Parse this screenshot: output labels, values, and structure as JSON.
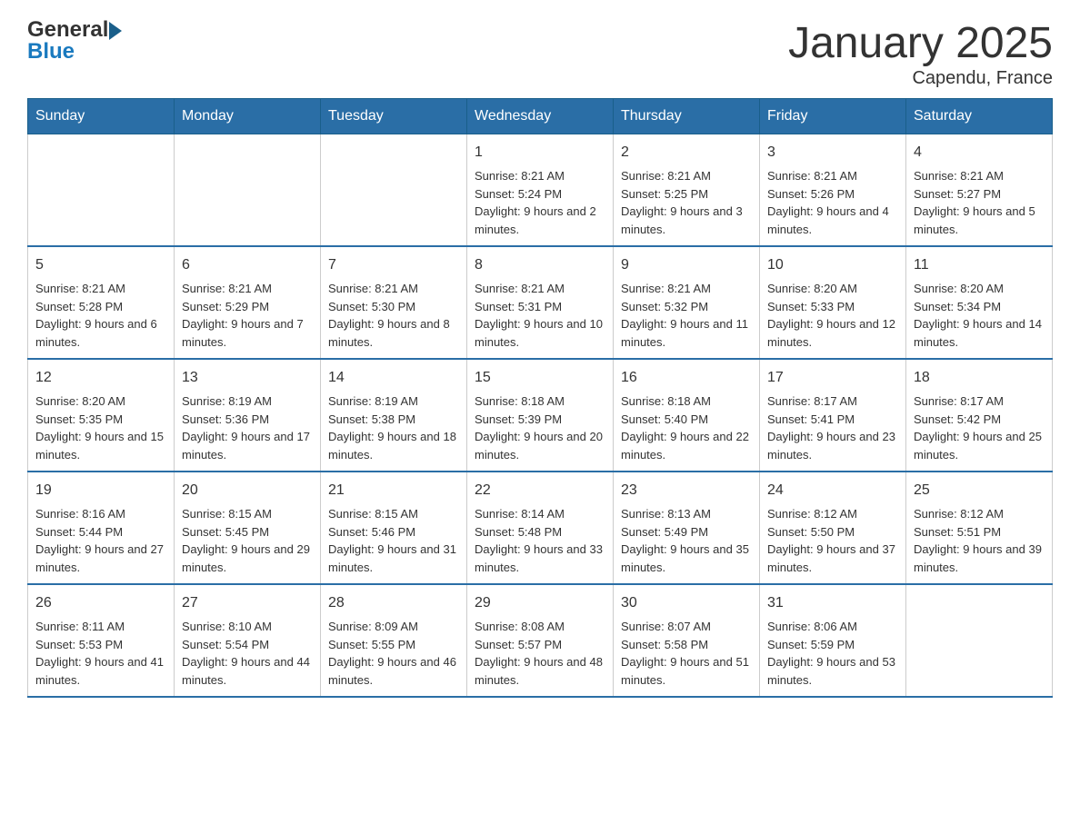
{
  "logo": {
    "line1": "General",
    "line2": "Blue"
  },
  "title": "January 2025",
  "subtitle": "Capendu, France",
  "days_header": [
    "Sunday",
    "Monday",
    "Tuesday",
    "Wednesday",
    "Thursday",
    "Friday",
    "Saturday"
  ],
  "weeks": [
    [
      {
        "day": "",
        "info": ""
      },
      {
        "day": "",
        "info": ""
      },
      {
        "day": "",
        "info": ""
      },
      {
        "day": "1",
        "info": "Sunrise: 8:21 AM\nSunset: 5:24 PM\nDaylight: 9 hours and 2 minutes."
      },
      {
        "day": "2",
        "info": "Sunrise: 8:21 AM\nSunset: 5:25 PM\nDaylight: 9 hours and 3 minutes."
      },
      {
        "day": "3",
        "info": "Sunrise: 8:21 AM\nSunset: 5:26 PM\nDaylight: 9 hours and 4 minutes."
      },
      {
        "day": "4",
        "info": "Sunrise: 8:21 AM\nSunset: 5:27 PM\nDaylight: 9 hours and 5 minutes."
      }
    ],
    [
      {
        "day": "5",
        "info": "Sunrise: 8:21 AM\nSunset: 5:28 PM\nDaylight: 9 hours and 6 minutes."
      },
      {
        "day": "6",
        "info": "Sunrise: 8:21 AM\nSunset: 5:29 PM\nDaylight: 9 hours and 7 minutes."
      },
      {
        "day": "7",
        "info": "Sunrise: 8:21 AM\nSunset: 5:30 PM\nDaylight: 9 hours and 8 minutes."
      },
      {
        "day": "8",
        "info": "Sunrise: 8:21 AM\nSunset: 5:31 PM\nDaylight: 9 hours and 10 minutes."
      },
      {
        "day": "9",
        "info": "Sunrise: 8:21 AM\nSunset: 5:32 PM\nDaylight: 9 hours and 11 minutes."
      },
      {
        "day": "10",
        "info": "Sunrise: 8:20 AM\nSunset: 5:33 PM\nDaylight: 9 hours and 12 minutes."
      },
      {
        "day": "11",
        "info": "Sunrise: 8:20 AM\nSunset: 5:34 PM\nDaylight: 9 hours and 14 minutes."
      }
    ],
    [
      {
        "day": "12",
        "info": "Sunrise: 8:20 AM\nSunset: 5:35 PM\nDaylight: 9 hours and 15 minutes."
      },
      {
        "day": "13",
        "info": "Sunrise: 8:19 AM\nSunset: 5:36 PM\nDaylight: 9 hours and 17 minutes."
      },
      {
        "day": "14",
        "info": "Sunrise: 8:19 AM\nSunset: 5:38 PM\nDaylight: 9 hours and 18 minutes."
      },
      {
        "day": "15",
        "info": "Sunrise: 8:18 AM\nSunset: 5:39 PM\nDaylight: 9 hours and 20 minutes."
      },
      {
        "day": "16",
        "info": "Sunrise: 8:18 AM\nSunset: 5:40 PM\nDaylight: 9 hours and 22 minutes."
      },
      {
        "day": "17",
        "info": "Sunrise: 8:17 AM\nSunset: 5:41 PM\nDaylight: 9 hours and 23 minutes."
      },
      {
        "day": "18",
        "info": "Sunrise: 8:17 AM\nSunset: 5:42 PM\nDaylight: 9 hours and 25 minutes."
      }
    ],
    [
      {
        "day": "19",
        "info": "Sunrise: 8:16 AM\nSunset: 5:44 PM\nDaylight: 9 hours and 27 minutes."
      },
      {
        "day": "20",
        "info": "Sunrise: 8:15 AM\nSunset: 5:45 PM\nDaylight: 9 hours and 29 minutes."
      },
      {
        "day": "21",
        "info": "Sunrise: 8:15 AM\nSunset: 5:46 PM\nDaylight: 9 hours and 31 minutes."
      },
      {
        "day": "22",
        "info": "Sunrise: 8:14 AM\nSunset: 5:48 PM\nDaylight: 9 hours and 33 minutes."
      },
      {
        "day": "23",
        "info": "Sunrise: 8:13 AM\nSunset: 5:49 PM\nDaylight: 9 hours and 35 minutes."
      },
      {
        "day": "24",
        "info": "Sunrise: 8:12 AM\nSunset: 5:50 PM\nDaylight: 9 hours and 37 minutes."
      },
      {
        "day": "25",
        "info": "Sunrise: 8:12 AM\nSunset: 5:51 PM\nDaylight: 9 hours and 39 minutes."
      }
    ],
    [
      {
        "day": "26",
        "info": "Sunrise: 8:11 AM\nSunset: 5:53 PM\nDaylight: 9 hours and 41 minutes."
      },
      {
        "day": "27",
        "info": "Sunrise: 8:10 AM\nSunset: 5:54 PM\nDaylight: 9 hours and 44 minutes."
      },
      {
        "day": "28",
        "info": "Sunrise: 8:09 AM\nSunset: 5:55 PM\nDaylight: 9 hours and 46 minutes."
      },
      {
        "day": "29",
        "info": "Sunrise: 8:08 AM\nSunset: 5:57 PM\nDaylight: 9 hours and 48 minutes."
      },
      {
        "day": "30",
        "info": "Sunrise: 8:07 AM\nSunset: 5:58 PM\nDaylight: 9 hours and 51 minutes."
      },
      {
        "day": "31",
        "info": "Sunrise: 8:06 AM\nSunset: 5:59 PM\nDaylight: 9 hours and 53 minutes."
      },
      {
        "day": "",
        "info": ""
      }
    ]
  ]
}
